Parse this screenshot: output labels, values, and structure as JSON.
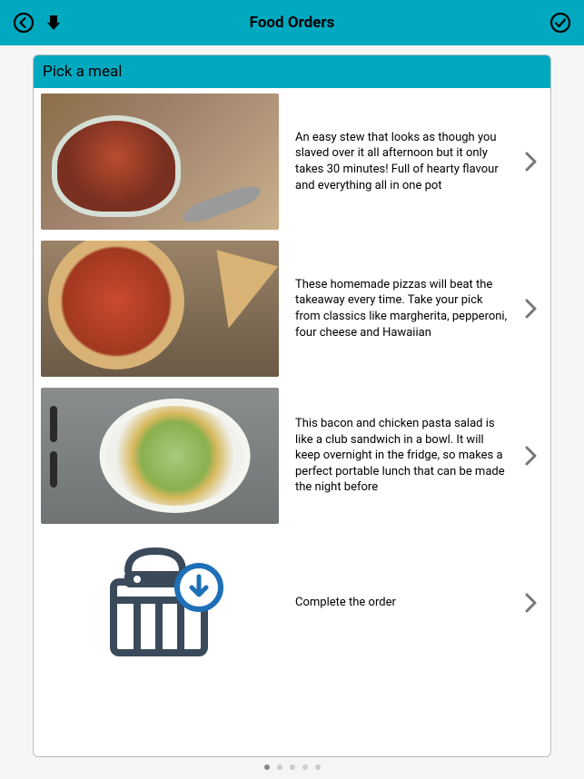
{
  "header": {
    "title": "Food Orders"
  },
  "card": {
    "title": "Pick a meal"
  },
  "meals": [
    {
      "description": "An easy stew that looks as though you slaved over it all afternoon but it only takes 30 minutes! Full of hearty flavour and everything all in one pot"
    },
    {
      "description": "These homemade pizzas will beat the takeaway every time. Take your pick from classics like margherita, pepperoni, four cheese and Hawaiian"
    },
    {
      "description": "This bacon and chicken pasta salad is like a club sandwich in a bowl. It will keep overnight in the fridge, so makes a perfect portable lunch that can be made the night before"
    }
  ],
  "complete": {
    "label": "Complete the order"
  },
  "pager": {
    "total": 5,
    "active": 0
  }
}
